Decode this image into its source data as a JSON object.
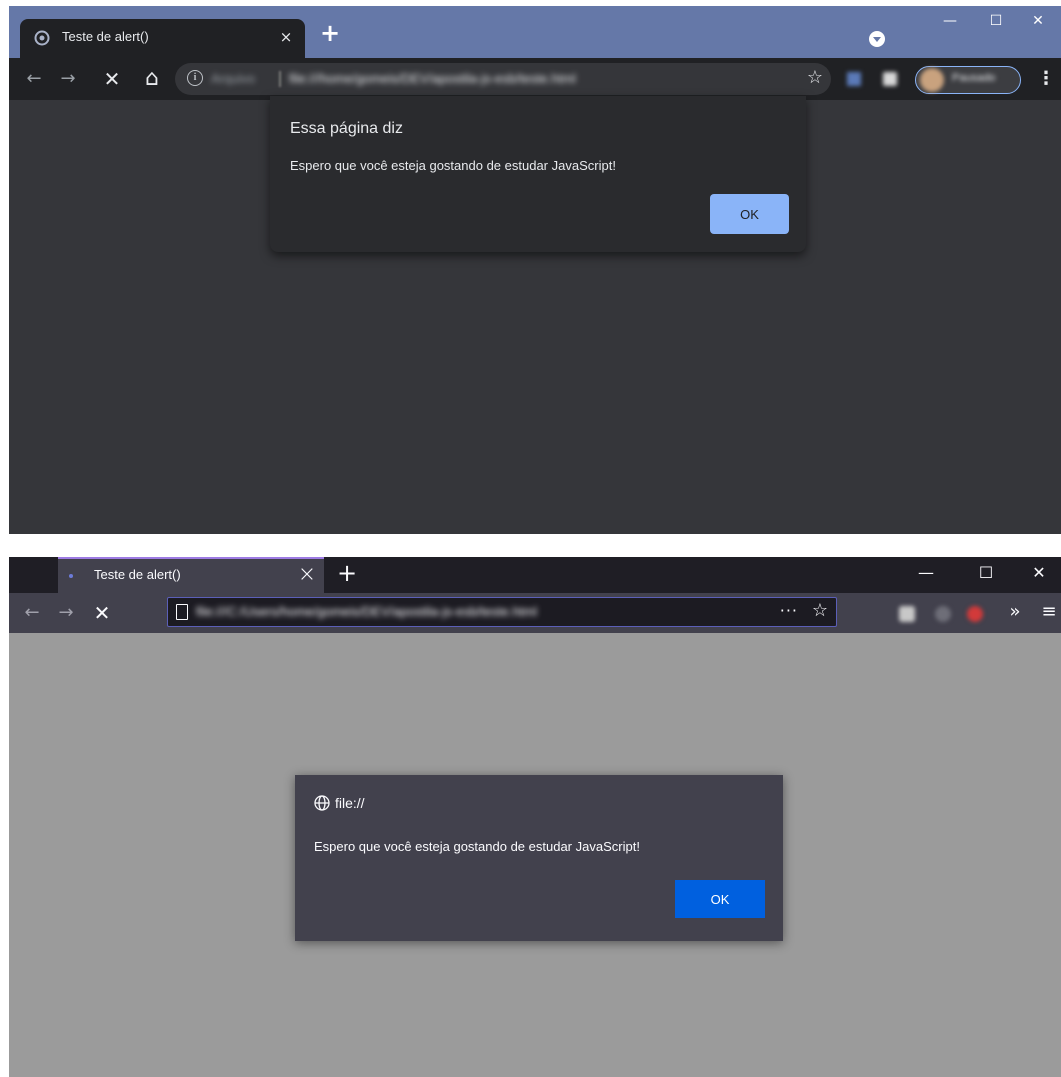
{
  "chrome": {
    "tab": {
      "title": "Teste de alert()",
      "close": "×",
      "favicon": "chromium-icon"
    },
    "new_tab": "+",
    "window_controls": {
      "minimize": "—",
      "maximize": "☐",
      "close": "✕"
    },
    "nav": {
      "back": "←",
      "forward": "→",
      "stop": "✕",
      "home": "⌂"
    },
    "omnibox": {
      "info": "i",
      "scheme": "Arquivo",
      "url": "file:///home/gomeis/DEV/apostila-js-esb/teste.html",
      "star": "☆"
    },
    "profile": {
      "name": "Pausado"
    },
    "menu": "⋮",
    "dialog": {
      "title": "Essa página diz",
      "message": "Espero que você esteja gostando de estudar JavaScript!",
      "ok_label": "OK"
    },
    "colors": {
      "frame": "#6578a8",
      "toolbar": "#202124",
      "content": "#35363a",
      "dialog": "#2a2b2e",
      "accent": "#8ab4f8"
    }
  },
  "firefox": {
    "tab": {
      "title": "Teste de alert()",
      "close": "×"
    },
    "new_tab": "+",
    "window_controls": {
      "minimize": "—",
      "maximize": "☐",
      "close": "✕"
    },
    "nav": {
      "back": "←",
      "forward": "→",
      "stop": "✕"
    },
    "urlbar": {
      "url": "file:///C:/Users/home/gomeis/DEV/apostila-js-esb/teste.html",
      "more": "···",
      "star": "☆"
    },
    "overflow": "»",
    "menu": "≡",
    "dialog": {
      "origin": "file://",
      "message": "Espero que você esteja gostando de estudar JavaScript!",
      "ok_label": "OK"
    },
    "colors": {
      "tabbar": "#1f1e25",
      "toolbar": "#42414d",
      "content": "#9b9b9b",
      "dialog": "#42414d",
      "accent": "#0060df"
    }
  }
}
